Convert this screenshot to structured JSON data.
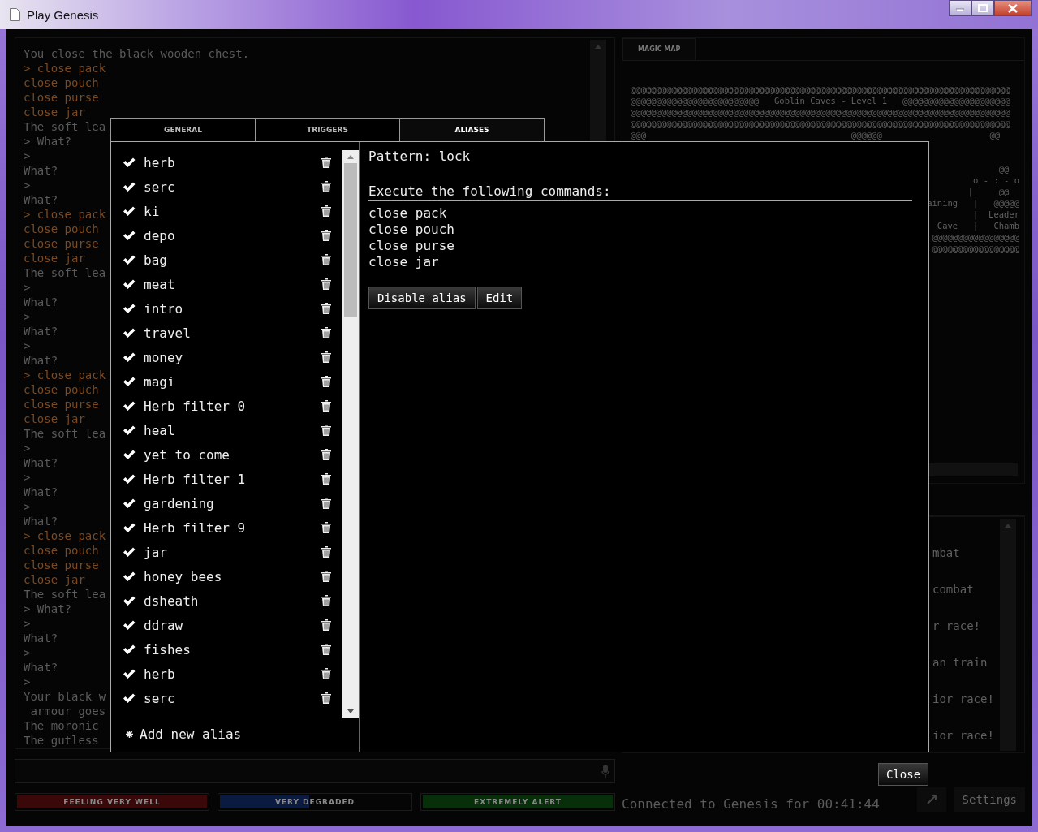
{
  "window": {
    "title": "Play Genesis"
  },
  "log": {
    "lines": [
      {
        "kind": "output",
        "text": "You close the black wooden chest."
      },
      {
        "kind": "command",
        "text": "> close pack"
      },
      {
        "kind": "command",
        "text": "close pouch"
      },
      {
        "kind": "command",
        "text": "close purse"
      },
      {
        "kind": "command",
        "text": "close jar"
      },
      {
        "kind": "output",
        "text": "The soft lea"
      },
      {
        "kind": "output",
        "text": "> What?"
      },
      {
        "kind": "output",
        "text": ">"
      },
      {
        "kind": "output",
        "text": "What?"
      },
      {
        "kind": "output",
        "text": ">"
      },
      {
        "kind": "output",
        "text": "What?"
      },
      {
        "kind": "command",
        "text": "> close pack"
      },
      {
        "kind": "command",
        "text": "close pouch"
      },
      {
        "kind": "command",
        "text": "close purse"
      },
      {
        "kind": "command",
        "text": "close jar"
      },
      {
        "kind": "output",
        "text": "The soft lea"
      },
      {
        "kind": "output",
        "text": ">"
      },
      {
        "kind": "output",
        "text": "What?"
      },
      {
        "kind": "output",
        "text": ">"
      },
      {
        "kind": "output",
        "text": "What?"
      },
      {
        "kind": "output",
        "text": ">"
      },
      {
        "kind": "output",
        "text": "What?"
      },
      {
        "kind": "command",
        "text": "> close pack"
      },
      {
        "kind": "command",
        "text": "close pouch"
      },
      {
        "kind": "command",
        "text": "close purse"
      },
      {
        "kind": "command",
        "text": "close jar"
      },
      {
        "kind": "output",
        "text": "The soft lea"
      },
      {
        "kind": "output",
        "text": ">"
      },
      {
        "kind": "output",
        "text": "What?"
      },
      {
        "kind": "output",
        "text": ">"
      },
      {
        "kind": "output",
        "text": "What?"
      },
      {
        "kind": "output",
        "text": ">"
      },
      {
        "kind": "output",
        "text": "What?"
      },
      {
        "kind": "command",
        "text": "> close pack"
      },
      {
        "kind": "command",
        "text": "close pouch"
      },
      {
        "kind": "command",
        "text": "close purse"
      },
      {
        "kind": "command",
        "text": "close jar"
      },
      {
        "kind": "output",
        "text": "The soft lea"
      },
      {
        "kind": "output",
        "text": "> What?"
      },
      {
        "kind": "output",
        "text": ">"
      },
      {
        "kind": "output",
        "text": "What?"
      },
      {
        "kind": "output",
        "text": ">"
      },
      {
        "kind": "output",
        "text": "What?"
      },
      {
        "kind": "output",
        "text": ">"
      },
      {
        "kind": "output",
        "text": "Your black w"
      },
      {
        "kind": "output",
        "text": " armour goes"
      },
      {
        "kind": "output",
        "text": "The moronic"
      },
      {
        "kind": "output",
        "text": "The gutless"
      }
    ]
  },
  "status_bars": [
    {
      "label": "FEELING VERY WELL",
      "color": "#3a0808",
      "level": 1
    },
    {
      "label": "VERY DEGRADED",
      "color": "#0a1a40",
      "level": 0.48
    },
    {
      "label": "EXTREMELY ALERT",
      "color": "#07300a",
      "level": 1
    }
  ],
  "map": {
    "tab": "MAGIC MAP",
    "rows": [
      "@@@@@@@@@@@@@@@@@@@@@@@@@@@@@@@@@@@@@@@@@@@@@@@@@@@@@@@@@@@@@@@@@@@@@@@@@@",
      "@@@@@@@@@@@@@@@@@@@@@@@@@   Goblin Caves - Level 1   @@@@@@@@@@@@@@@@@@@@@",
      "@@@@@@@@@@@@@@@@@@@@@@@@@@@@@@@@@@@@@@@@@@@@@@@@@@@@@@@@@@@@@@@@@@@@@@@@@@",
      "@@@@@@@@@@@@@@@@@@@@@@@@@@@@@@@@@@@@@@@@@@@@@@@@@@@@@@@@@@@@@@@@@@@@@@@@@@",
      "@@@                                        @@@@@@                     @@"
    ],
    "row_tails": [
      "@@  ",
      "o - : - o",
      "|     @@  ",
      "aining   |   @@@@@",
      "|  Leader",
      "Cave   |   Chamb",
      "@@@@@@@@@@@@@@@@@",
      "@@@@@@@@@@@@@@@@@"
    ]
  },
  "communication": {
    "line_tails": [
      "mbat",
      "combat",
      "r race!",
      "an train",
      "ior race!",
      "ior race!"
    ]
  },
  "connection_status": "Connected to Genesis for 00:41:44",
  "settings_button": "Settings",
  "dialog": {
    "tabs": [
      {
        "label": "GENERAL",
        "selected": false
      },
      {
        "label": "TRIGGERS",
        "selected": false
      },
      {
        "label": "ALIASES",
        "selected": true
      }
    ],
    "aliases": [
      {
        "name": "herb",
        "enabled": true
      },
      {
        "name": "serc",
        "enabled": true
      },
      {
        "name": "ki",
        "enabled": true
      },
      {
        "name": "depo",
        "enabled": true
      },
      {
        "name": "bag",
        "enabled": true
      },
      {
        "name": "meat",
        "enabled": true
      },
      {
        "name": "intro",
        "enabled": true
      },
      {
        "name": "travel",
        "enabled": true
      },
      {
        "name": "money",
        "enabled": true
      },
      {
        "name": "magi",
        "enabled": true
      },
      {
        "name": "Herb filter 0",
        "enabled": true
      },
      {
        "name": "heal",
        "enabled": true
      },
      {
        "name": "yet to come",
        "enabled": true
      },
      {
        "name": "Herb filter 1",
        "enabled": true
      },
      {
        "name": "gardening",
        "enabled": true
      },
      {
        "name": "Herb filter 9",
        "enabled": true
      },
      {
        "name": "jar",
        "enabled": true
      },
      {
        "name": "honey bees",
        "enabled": true
      },
      {
        "name": "dsheath",
        "enabled": true
      },
      {
        "name": "ddraw",
        "enabled": true
      },
      {
        "name": "fishes",
        "enabled": true
      },
      {
        "name": "herb",
        "enabled": true
      },
      {
        "name": "serc",
        "enabled": true
      }
    ],
    "add_label": "Add new alias",
    "pattern": "Pattern: lock",
    "execute_heading": "Execute the following commands:",
    "commands": [
      "close pack",
      "close pouch",
      "close purse",
      "close jar"
    ],
    "buttons": [
      "Disable alias",
      "Edit"
    ]
  },
  "close_button": "Close"
}
